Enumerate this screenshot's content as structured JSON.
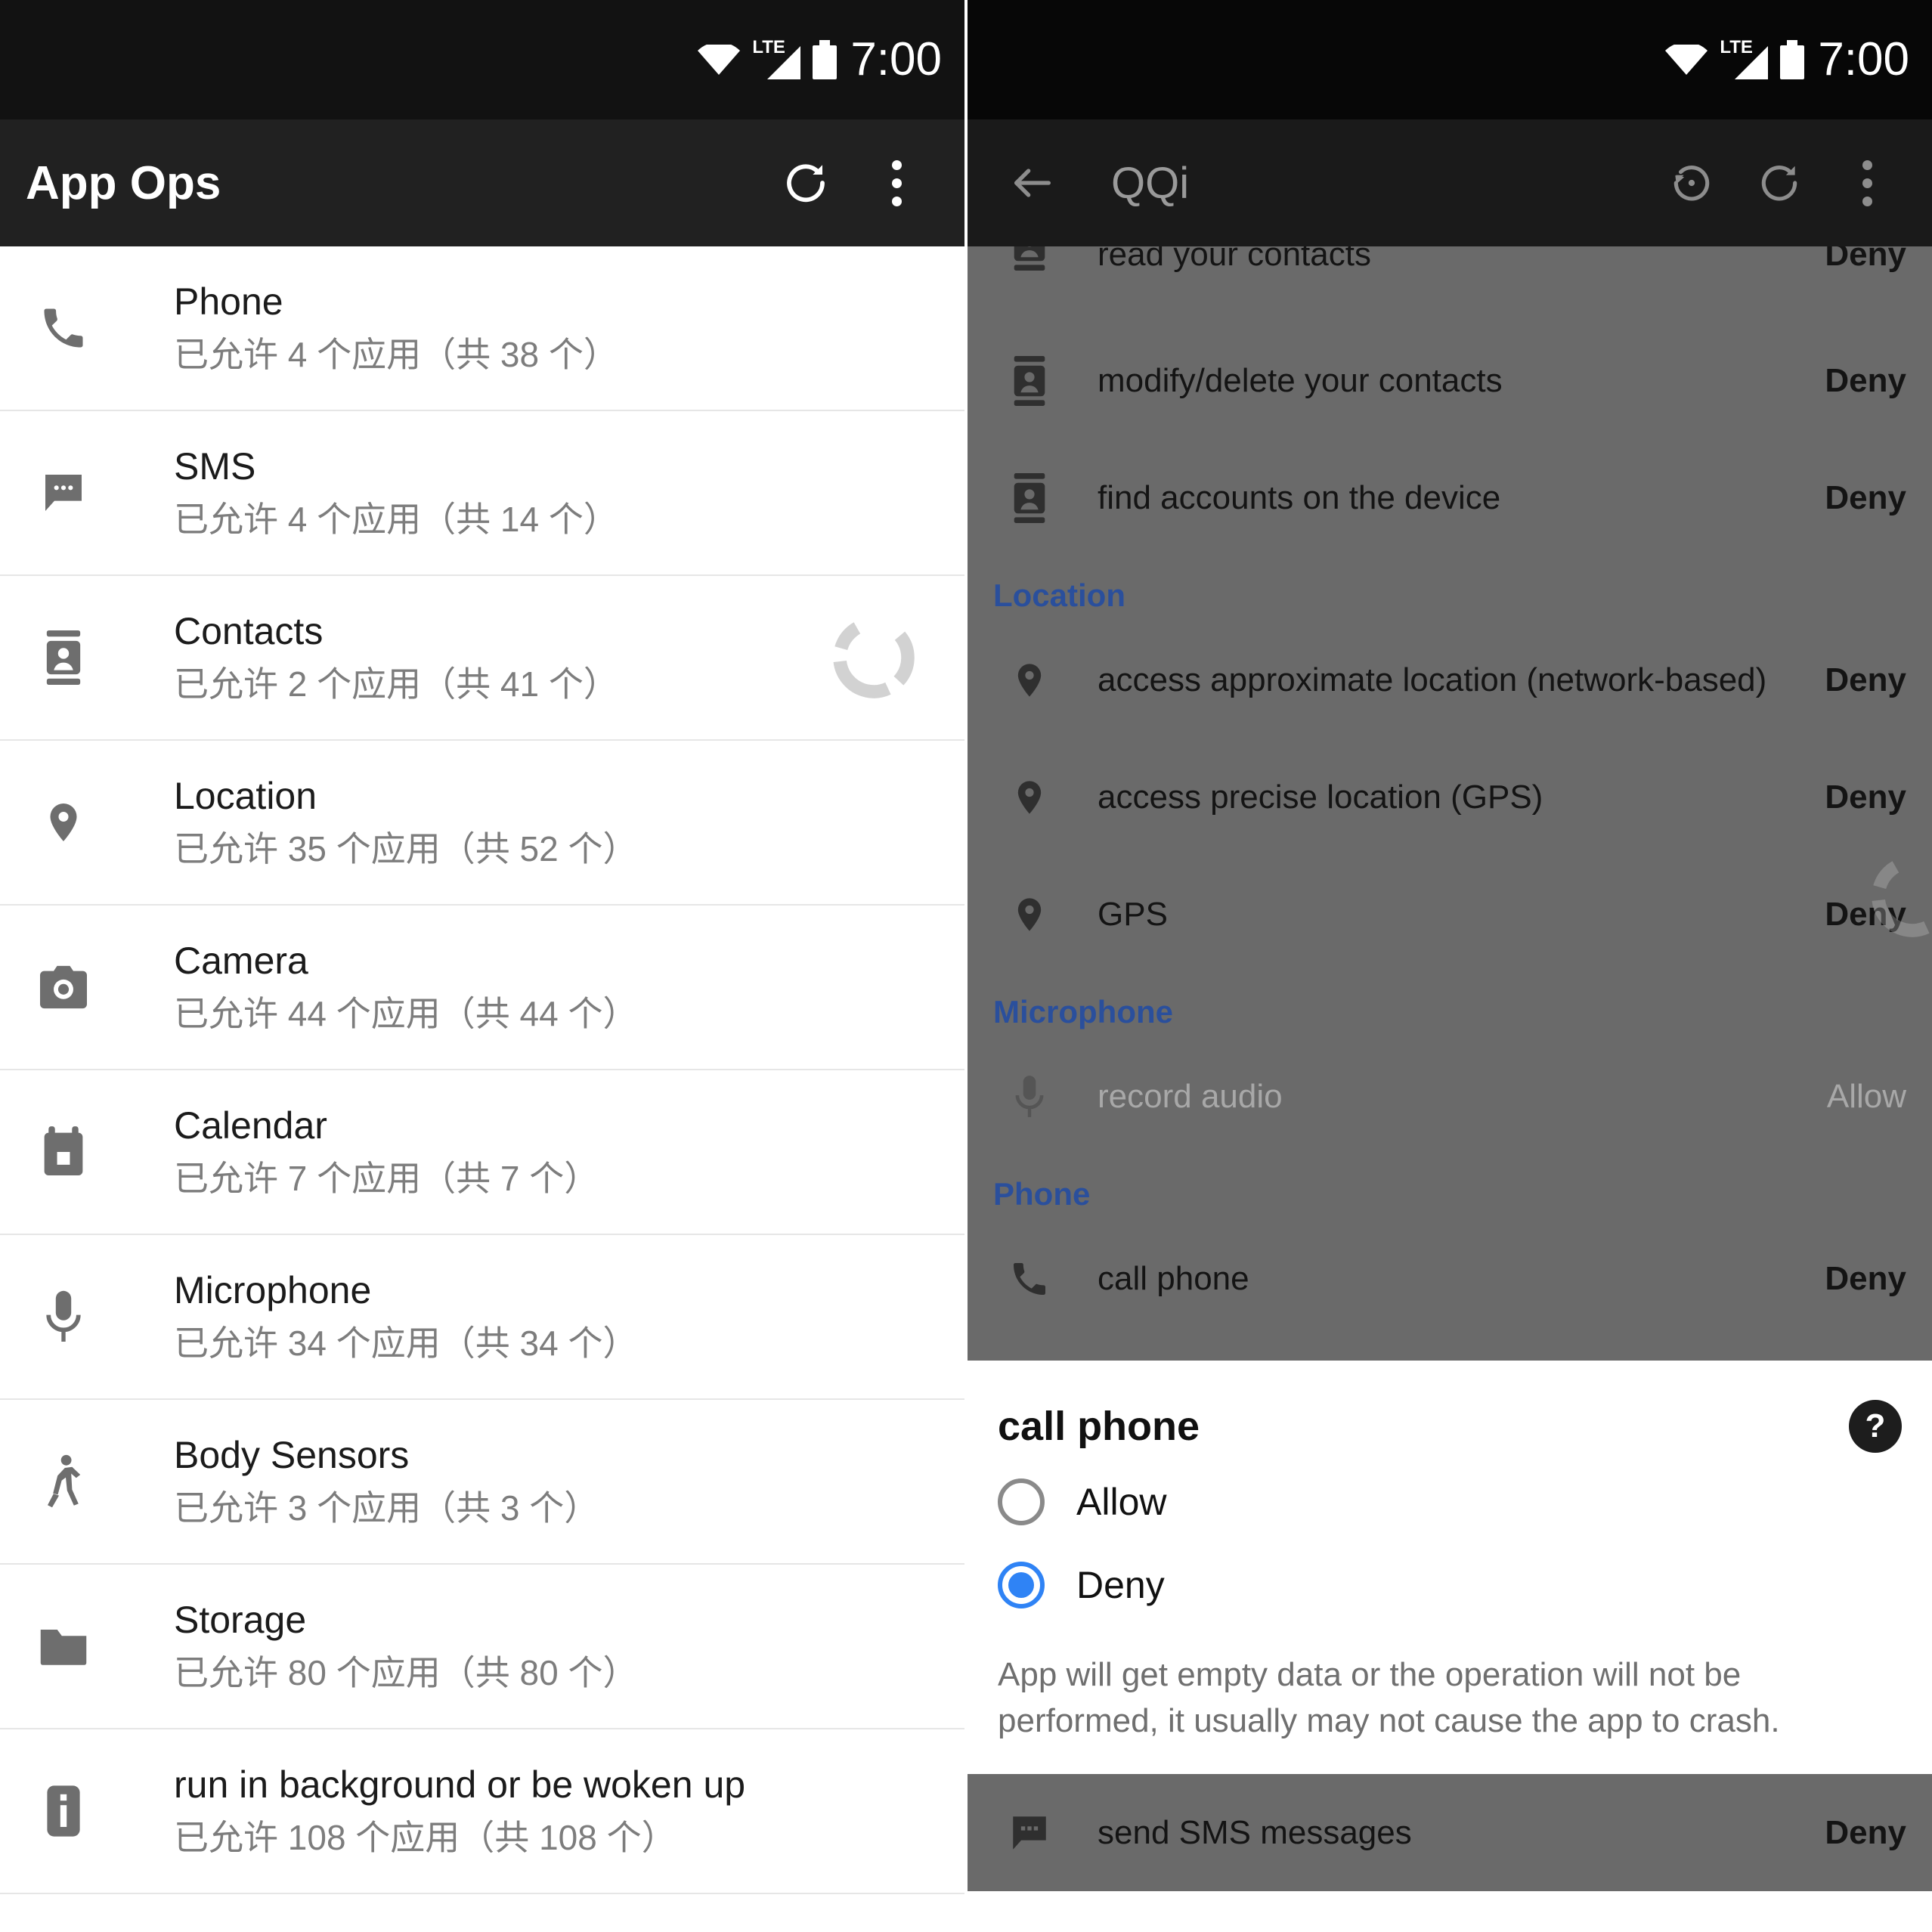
{
  "status_bar": {
    "time": "7:00",
    "network_label": "LTE",
    "icons": [
      "wifi-icon",
      "lte-signal-icon",
      "battery-icon"
    ]
  },
  "left_panel": {
    "toolbar": {
      "title": "App Ops",
      "refresh_icon": "refresh-icon",
      "overflow_icon": "overflow-menu-icon"
    },
    "permission_groups": [
      {
        "icon": "phone-icon",
        "name": "Phone",
        "summary": "已允许 4 个应用（共 38 个）",
        "loading": false
      },
      {
        "icon": "sms-icon",
        "name": "SMS",
        "summary": "已允许 4 个应用（共 14 个）",
        "loading": false
      },
      {
        "icon": "contacts-icon",
        "name": "Contacts",
        "summary": "已允许 2 个应用（共 41 个）",
        "loading": true
      },
      {
        "icon": "location-icon",
        "name": "Location",
        "summary": "已允许 35 个应用（共 52 个）",
        "loading": false
      },
      {
        "icon": "camera-icon",
        "name": "Camera",
        "summary": "已允许 44 个应用（共 44 个）",
        "loading": false
      },
      {
        "icon": "calendar-icon",
        "name": "Calendar",
        "summary": "已允许 7 个应用（共 7 个）",
        "loading": false
      },
      {
        "icon": "microphone-icon",
        "name": "Microphone",
        "summary": "已允许 34 个应用（共 34 个）",
        "loading": false
      },
      {
        "icon": "body-sensors-icon",
        "name": "Body Sensors",
        "summary": "已允许 3 个应用（共 3 个）",
        "loading": false
      },
      {
        "icon": "storage-icon",
        "name": "Storage",
        "summary": "已允许 80 个应用（共 80 个）",
        "loading": false
      },
      {
        "icon": "run-background-icon",
        "name": "run in background or be woken up",
        "summary": "已允许 108 个应用（共 108 个）",
        "loading": false
      }
    ]
  },
  "right_panel": {
    "toolbar": {
      "back_icon": "back-arrow-icon",
      "title": "QQi",
      "history_icon": "restore-history-icon",
      "refresh_icon": "refresh-icon",
      "overflow_icon": "overflow-menu-icon"
    },
    "ops": [
      {
        "type": "op",
        "icon": "contacts-icon",
        "label": "read your contacts",
        "value": "Deny",
        "dim": false
      },
      {
        "type": "op",
        "icon": "contacts-icon",
        "label": "modify/delete your contacts",
        "value": "Deny",
        "dim": false
      },
      {
        "type": "op",
        "icon": "contacts-icon",
        "label": "find accounts on the device",
        "value": "Deny",
        "dim": false
      },
      {
        "type": "section",
        "label": "Location"
      },
      {
        "type": "op",
        "icon": "location-icon",
        "label": "access approximate location (network-based)",
        "value": "Deny",
        "dim": false
      },
      {
        "type": "op",
        "icon": "location-icon",
        "label": "access precise location (GPS)",
        "value": "Deny",
        "dim": false
      },
      {
        "type": "op",
        "icon": "location-icon",
        "label": "GPS",
        "value": "Deny",
        "dim": false
      },
      {
        "type": "section",
        "label": "Microphone"
      },
      {
        "type": "op",
        "icon": "microphone-icon",
        "label": "record audio",
        "value": "Allow",
        "dim": true
      },
      {
        "type": "section",
        "label": "Phone"
      },
      {
        "type": "op",
        "icon": "phone-icon",
        "label": "call phone",
        "value": "Deny",
        "dim": false
      }
    ],
    "dialog": {
      "title": "call phone",
      "help_glyph": "?",
      "help_icon": "help-icon",
      "options": [
        {
          "label": "Allow",
          "selected": false
        },
        {
          "label": "Deny",
          "selected": true
        }
      ],
      "description": "App will get empty data or the operation will not be performed, it usually may not cause the app to crash.",
      "selected_value": "Deny"
    },
    "bottom_row": {
      "icon": "sms-icon",
      "label": "send SMS messages",
      "value": "Deny"
    }
  },
  "colors": {
    "status_bar_bg": "#121212",
    "toolbar_bg": "#212121",
    "section_header": "#2a4f9c",
    "accent_radio": "#2f83f5",
    "scrim": "#6a6a6a",
    "divider": "#e6e6e6"
  }
}
